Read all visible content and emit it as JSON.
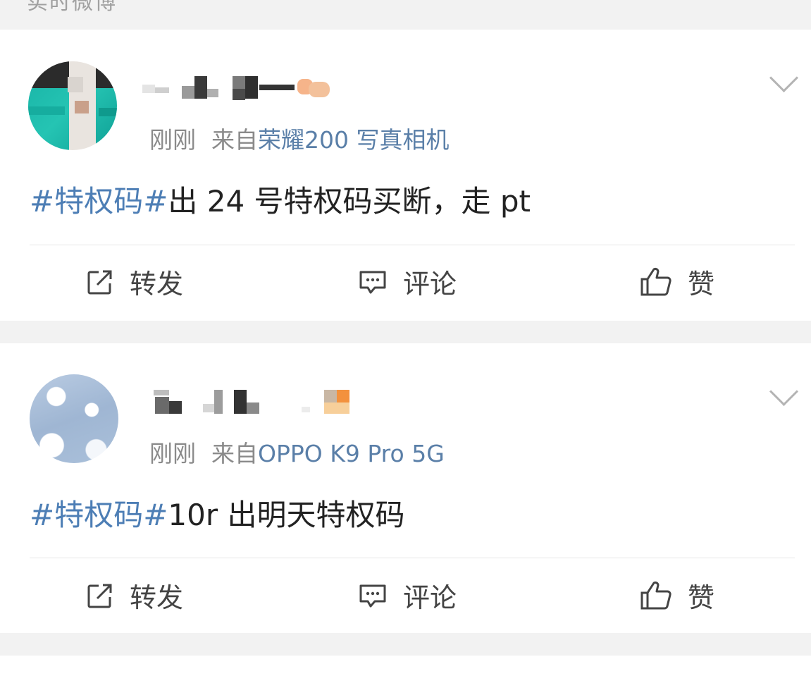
{
  "header": {
    "title": "实时微博"
  },
  "posts": [
    {
      "time": "刚刚",
      "from_label": "来自",
      "device": "荣耀200 写真相机",
      "hashtag": "#特权码#",
      "text": "出 24 号特权码买断，走 pt",
      "actions": {
        "repost": "转发",
        "comment": "评论",
        "like": "赞"
      }
    },
    {
      "time": "刚刚",
      "from_label": "来自",
      "device": "OPPO K9 Pro 5G",
      "hashtag": "#特权码#",
      "text": "10r 出明天特权码",
      "actions": {
        "repost": "转发",
        "comment": "评论",
        "like": "赞"
      }
    }
  ],
  "colors": {
    "hashtag": "#4d7eb5",
    "device": "#5a7fa8",
    "meta": "#8a8a8a",
    "text": "#222222",
    "background": "#f2f2f2"
  },
  "icons": [
    "repost-icon",
    "comment-icon",
    "like-icon",
    "chevron-down-icon"
  ]
}
